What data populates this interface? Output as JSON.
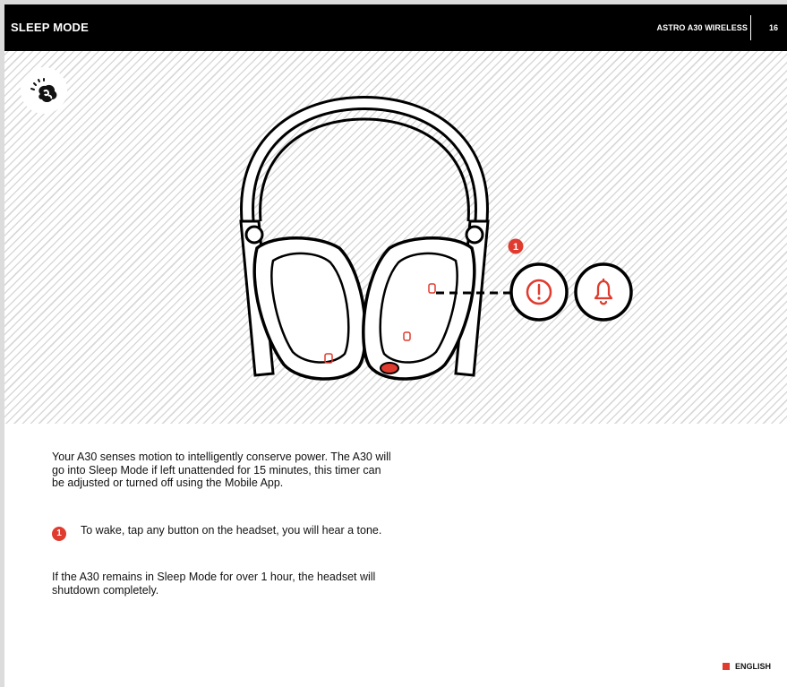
{
  "header": {
    "section_title": "SLEEP MODE",
    "product_name": "ASTRO A30 WIRELESS",
    "page_number": "16"
  },
  "illustration": {
    "callout_number": "1",
    "mode_icon": "sleep-mode-icon",
    "warning_icon": "exclamation-circle-icon",
    "bell_icon": "bell-icon",
    "accent_color": "#e03b2f"
  },
  "body": {
    "intro": "Your A30 senses motion to intelligently conserve power. The A30 will go into Sleep Mode if left unattended for 15 minutes, this timer can be adjusted or turned off using the Mobile App.",
    "step_number": "1",
    "step_text": "To wake, tap any button on the headset, you will hear a tone.",
    "outro": "If the A30 remains in Sleep Mode for over 1 hour, the headset will shutdown completely."
  },
  "footer": {
    "language": "ENGLISH"
  }
}
